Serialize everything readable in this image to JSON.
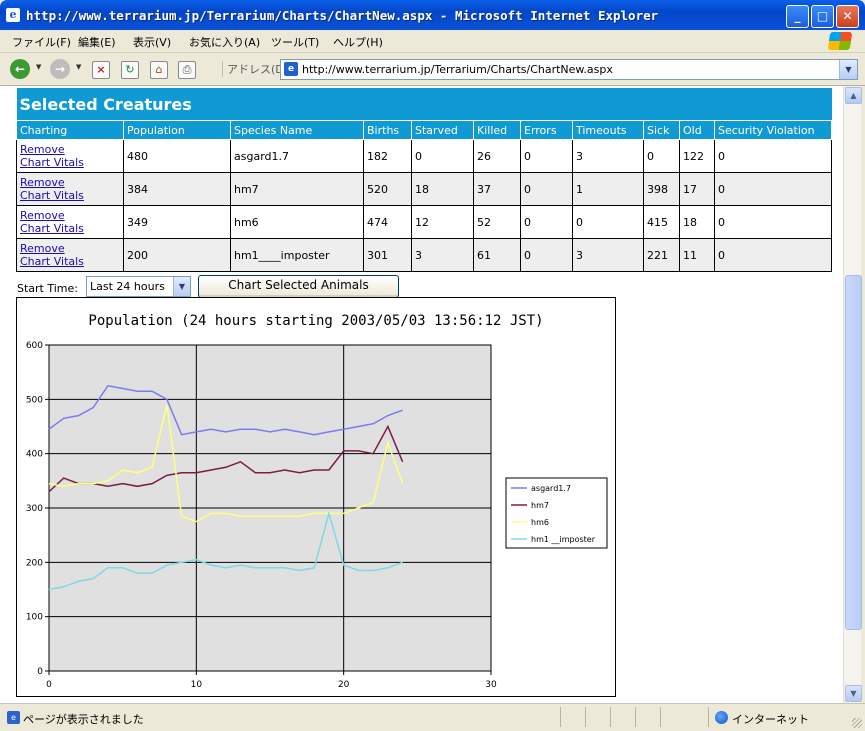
{
  "window": {
    "title": "http://www.terrarium.jp/Terrarium/Charts/ChartNew.aspx - Microsoft Internet Explorer",
    "min_glyph": "_",
    "max_glyph": "□",
    "close_glyph": "✕"
  },
  "menu": [
    "ファイル(F)",
    "編集(E)",
    "表示(V)",
    "お気に入り(A)",
    "ツール(T)",
    "ヘルプ(H)"
  ],
  "toolbar": {
    "address_label": "アドレス(D)",
    "url": "http://www.terrarium.jp/Terrarium/Charts/ChartNew.aspx"
  },
  "creatures": {
    "caption": "Selected Creatures",
    "columns": [
      "Charting",
      "Population",
      "Species Name",
      "Births",
      "Starved",
      "Killed",
      "Errors",
      "Timeouts",
      "Sick",
      "Old",
      "Security Violation"
    ],
    "remove_label": "Remove",
    "vitals_label": "Chart Vitals",
    "rows": [
      [
        "480",
        "asgard1.7",
        "182",
        "0",
        "26",
        "0",
        "3",
        "0",
        "122",
        "0"
      ],
      [
        "384",
        "hm7",
        "520",
        "18",
        "37",
        "0",
        "1",
        "398",
        "17",
        "0"
      ],
      [
        "349",
        "hm6",
        "474",
        "12",
        "52",
        "0",
        "0",
        "415",
        "18",
        "0"
      ],
      [
        "200",
        "hm1____imposter",
        "301",
        "3",
        "61",
        "0",
        "3",
        "221",
        "11",
        "0"
      ]
    ]
  },
  "controls": {
    "start_time_label": "Start Time:",
    "start_time_value": "Last 24 hours",
    "chart_button": "Chart Selected Animals"
  },
  "status": {
    "text": "ページが表示されました",
    "zone": "インターネット"
  },
  "chart_data": {
    "type": "line",
    "title": "Population (24 hours starting 2003/05/03 13:56:12 JST)",
    "xlim": [
      0,
      30
    ],
    "ylim": [
      0,
      600
    ],
    "xticks": [
      0,
      10,
      20,
      30
    ],
    "yticks": [
      0,
      100,
      200,
      300,
      400,
      500,
      600
    ],
    "grid": true,
    "legend": "right",
    "x": [
      0,
      1,
      2,
      3,
      4,
      5,
      6,
      7,
      8,
      9,
      10,
      11,
      12,
      13,
      14,
      15,
      16,
      17,
      18,
      19,
      20,
      21,
      22,
      23,
      24
    ],
    "series": [
      {
        "name": "asgard1.7",
        "color": "#7b7bef",
        "values": [
          445,
          465,
          470,
          485,
          525,
          520,
          515,
          515,
          500,
          435,
          440,
          445,
          440,
          445,
          445,
          440,
          445,
          440,
          435,
          440,
          445,
          450,
          455,
          470,
          480
        ]
      },
      {
        "name": "hm7",
        "color": "#7a1c48",
        "values": [
          330,
          355,
          345,
          345,
          340,
          345,
          340,
          345,
          360,
          365,
          365,
          370,
          375,
          385,
          365,
          365,
          370,
          365,
          370,
          370,
          405,
          405,
          400,
          450,
          385
        ]
      },
      {
        "name": "hm6",
        "color": "#ffff80",
        "values": [
          345,
          340,
          345,
          345,
          350,
          370,
          365,
          375,
          490,
          285,
          275,
          290,
          290,
          285,
          285,
          285,
          285,
          285,
          290,
          290,
          290,
          300,
          310,
          420,
          345
        ]
      },
      {
        "name": "hm1 __imposter",
        "color": "#80d8e8",
        "values": [
          150,
          155,
          165,
          170,
          190,
          190,
          180,
          180,
          195,
          200,
          205,
          195,
          190,
          195,
          190,
          190,
          190,
          185,
          190,
          290,
          195,
          185,
          185,
          190,
          200
        ]
      }
    ]
  }
}
